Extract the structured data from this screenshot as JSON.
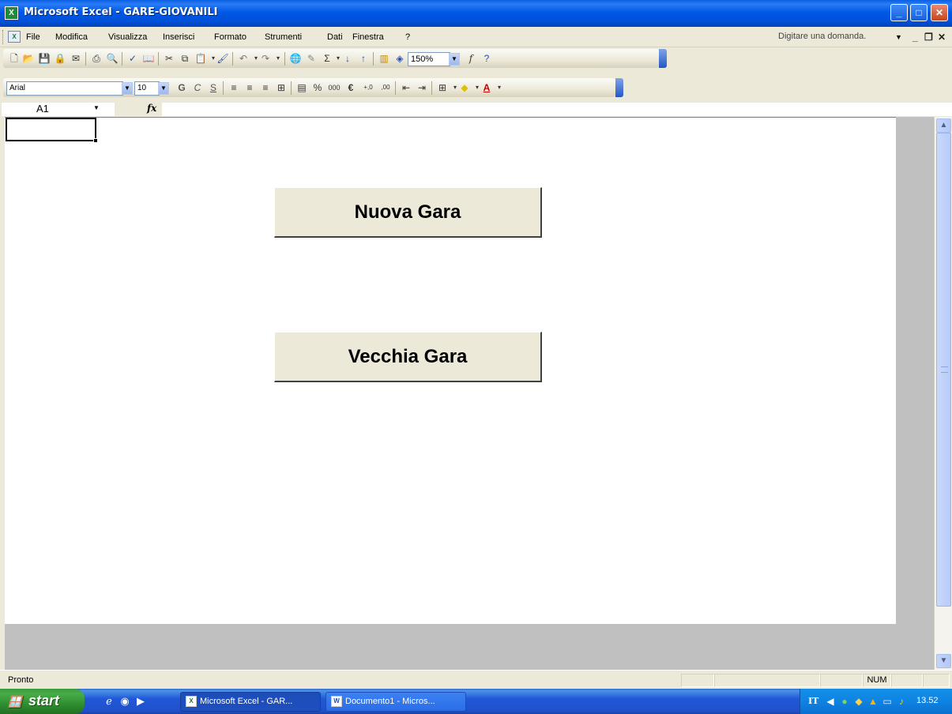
{
  "window": {
    "title": "Microsoft Excel - GARE-GIOVANILI",
    "app_icon": "X",
    "controls": {
      "minimize": "_",
      "maximize": "□",
      "close": "✕"
    }
  },
  "menubar": {
    "items": [
      {
        "label": "File",
        "accel": "F"
      },
      {
        "label": "Modifica",
        "accel": "M"
      },
      {
        "label": "Visualizza",
        "accel": "V"
      },
      {
        "label": "Inserisci",
        "accel": "I"
      },
      {
        "label": "Formato",
        "accel": "o"
      },
      {
        "label": "Strumenti",
        "accel": "S"
      },
      {
        "label": "Dati",
        "accel": "D"
      },
      {
        "label": "Finestra",
        "accel": "n"
      },
      {
        "label": "?",
        "accel": ""
      }
    ],
    "ask_placeholder": "Digitare una domanda.",
    "mdi": {
      "minimize": "_",
      "restore": "❐",
      "close": "✕"
    }
  },
  "standard_toolbar": {
    "icons": [
      "new-icon",
      "open-icon",
      "save-icon",
      "permission-icon",
      "print-icon",
      "print-preview-icon",
      "spelling-icon",
      "research-icon",
      "cut-icon",
      "copy-icon",
      "paste-icon",
      "format-painter-icon",
      "undo-icon",
      "redo-icon",
      "hyperlink-icon",
      "autosum-icon",
      "sort-ascending-icon",
      "sort-descending-icon",
      "chart-wizard-icon",
      "drawing-icon",
      "help-icon"
    ],
    "zoom": "150%"
  },
  "formatting_toolbar": {
    "font": "Arial",
    "size": "10",
    "bold": "G",
    "italic": "C",
    "underline": "S",
    "percent": "%",
    "thousands": "000",
    "euro": "€",
    "inc_decimal": "+,0",
    "dec_decimal": ",00"
  },
  "formula_bar": {
    "name_box": "A1",
    "fx": "fx",
    "value": ""
  },
  "sheet": {
    "buttons": [
      {
        "label": "Nuova Gara"
      },
      {
        "label": "Vecchia Gara"
      }
    ]
  },
  "statusbar": {
    "text": "Pronto",
    "num": "NUM"
  },
  "taskbar": {
    "start": "start",
    "tasks": [
      {
        "label": "Microsoft Excel - GAR...",
        "active": true
      },
      {
        "label": "Documento1 - Micros...",
        "active": false
      }
    ],
    "lang": "IT",
    "clock": "13.52"
  }
}
